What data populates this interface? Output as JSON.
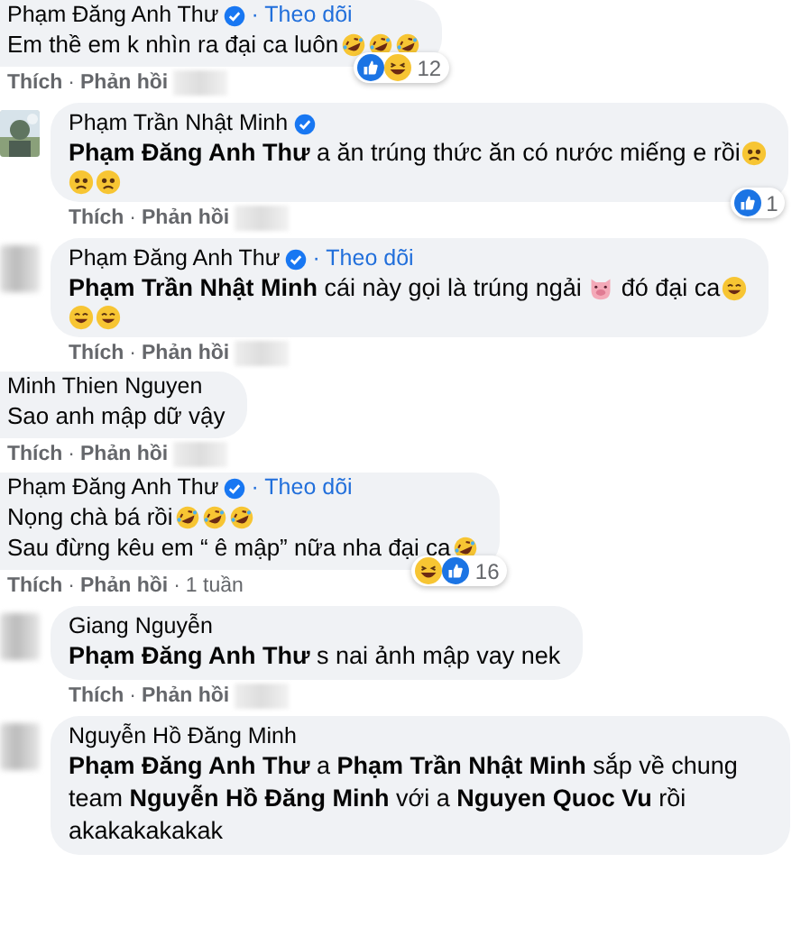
{
  "separator": "·",
  "comments": [
    {
      "kind": "top",
      "author": "Phạm Đăng Anh Thư",
      "verified": true,
      "follow": "· Theo dõi",
      "lines": [
        [
          {
            "kind": "text",
            "text": "Em thề em k nhìn ra đại ca luôn"
          },
          {
            "kind": "rofl"
          },
          {
            "kind": "rofl"
          },
          {
            "kind": "rofl"
          }
        ]
      ],
      "reactions": {
        "icons": [
          {
            "kind": "like"
          },
          {
            "kind": "haha"
          }
        ],
        "count": "12"
      },
      "actions": [
        "Thích",
        "Phản hồi"
      ],
      "time_blurred": true
    },
    {
      "kind": "reply",
      "author": "Phạm Trần Nhật Minh",
      "verified": true,
      "lines": [
        [
          {
            "kind": "text",
            "text": "**Phạm Đăng Anh Thư** a ăn trúng thức ăn có nước miếng e rồi"
          },
          {
            "kind": "sad"
          }
        ],
        [
          {
            "kind": "sad"
          },
          {
            "kind": "sad"
          }
        ]
      ],
      "reactions": {
        "icons": [
          {
            "kind": "like"
          }
        ],
        "count": "1"
      },
      "actions": [
        "Thích",
        "Phản hồi"
      ],
      "time_blurred": true
    },
    {
      "kind": "reply",
      "avatar": {
        "kind": "blurred"
      },
      "author": "Phạm Đăng Anh Thư",
      "verified": true,
      "follow": "· Theo dõi",
      "lines": [
        [
          {
            "kind": "text",
            "text": "**Phạm Trần Nhật Minh** cái này gọi là trúng ngải"
          },
          {
            "kind": "pig"
          },
          {
            "kind": "text",
            "text": "đó đại ca"
          },
          {
            "kind": "grin"
          }
        ],
        [
          {
            "kind": "grin"
          },
          {
            "kind": "grin"
          }
        ]
      ],
      "actions": [
        "Thích",
        "Phản hồi"
      ],
      "time_blurred": true
    },
    {
      "kind": "top",
      "author": "Minh Thien Nguyen",
      "verified": false,
      "lines": [
        [
          {
            "kind": "text",
            "text": "Sao anh mập dữ vậy"
          }
        ]
      ],
      "actions": [
        "Thích",
        "Phản hồi"
      ],
      "time_blurred": true
    },
    {
      "kind": "top",
      "author": "Phạm Đăng Anh Thư",
      "verified": true,
      "follow": "· Theo dõi",
      "lines": [
        [
          {
            "kind": "text",
            "text": "Nọng chà bá rồi"
          },
          {
            "kind": "rofl"
          },
          {
            "kind": "rofl"
          },
          {
            "kind": "rofl"
          }
        ],
        [
          {
            "kind": "text",
            "text": "Sau đừng kêu em “ ê mập” nữa nha đại ca"
          },
          {
            "kind": "rofl"
          }
        ]
      ],
      "reactions": {
        "icons": [
          {
            "kind": "haha"
          },
          {
            "kind": "like"
          }
        ],
        "count": "16"
      },
      "actions": [
        "Thích",
        "Phản hồi"
      ],
      "time": "1 tuần",
      "time_blurred": false
    },
    {
      "kind": "reply",
      "avatar": {
        "kind": "blurred"
      },
      "author": "Giang Nguyễn",
      "verified": false,
      "lines": [
        [
          {
            "kind": "text",
            "text": "**Phạm Đăng Anh Thư** s nai ảnh mập vay nek"
          }
        ]
      ],
      "actions": [
        "Thích",
        "Phản hồi"
      ],
      "time_blurred": true
    },
    {
      "kind": "reply",
      "avatar": {
        "kind": "blurred"
      },
      "author": "Nguyễn Hồ Đăng Minh",
      "verified": false,
      "lines": [
        [
          {
            "kind": "text",
            "text": "**Phạm Đăng Anh Thư** a **Phạm Trần Nhật Minh** sắp về chung team **Nguyễn Hồ Đăng Minh** với a **Nguyen Quoc Vu** rồi akakakakakak"
          }
        ]
      ]
    }
  ]
}
